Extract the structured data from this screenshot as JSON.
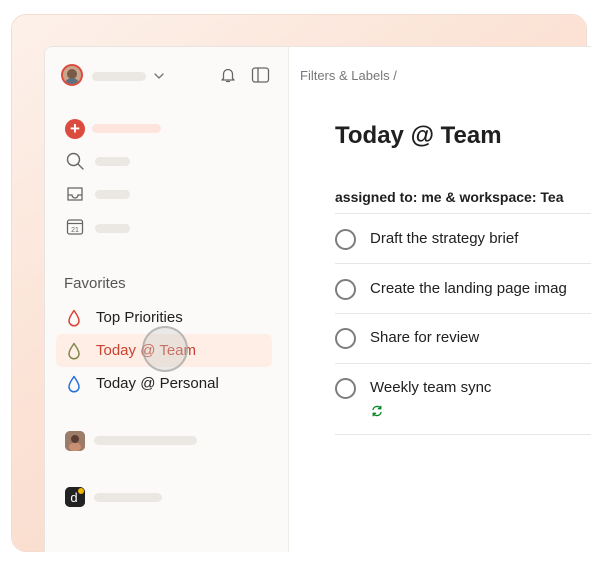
{
  "sidebar": {
    "favorites_heading": "Favorites",
    "favorites": [
      {
        "label": "Top Priorities",
        "color": "#db4035"
      },
      {
        "label": "Today @ Team",
        "color": "#7e8a4a",
        "active": true
      },
      {
        "label": "Today @ Personal",
        "color": "#246fe0"
      }
    ]
  },
  "main": {
    "breadcrumb": "Filters & Labels /",
    "title": "Today @ Team",
    "filter_query": "assigned to: me & workspace: Tea",
    "tasks": [
      {
        "title": "Draft the strategy brief"
      },
      {
        "title": "Create the landing page imag"
      },
      {
        "title": "Share for review"
      },
      {
        "title": "Weekly team sync",
        "recurring": true
      }
    ]
  },
  "colors": {
    "accent": "#dc4c3e",
    "active_bg": "#feeee5",
    "recurring": "#058527"
  },
  "icons": [
    "avatar",
    "chevron-down-icon",
    "bell-icon",
    "sidebar-toggle-icon",
    "add-task-icon",
    "search-icon",
    "inbox-icon",
    "calendar-icon",
    "drop-icon",
    "recurring-icon"
  ]
}
